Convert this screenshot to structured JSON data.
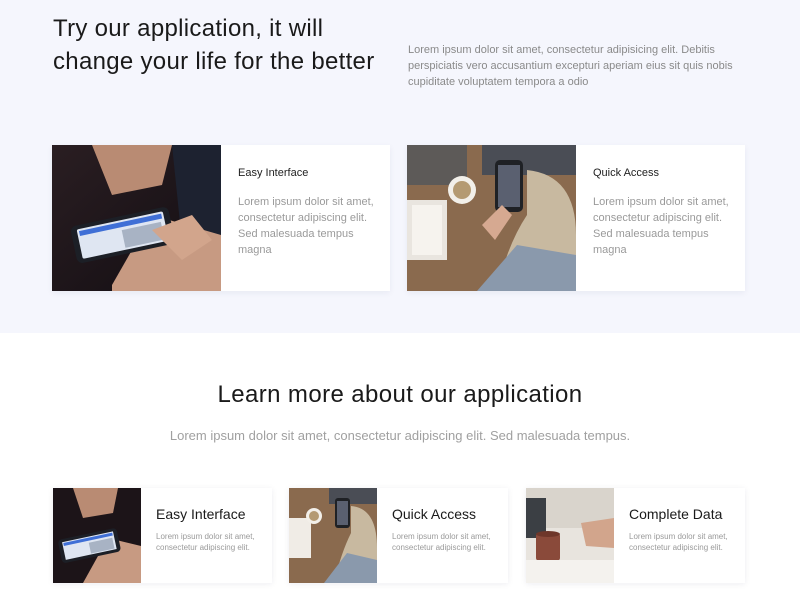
{
  "hero": {
    "title": "Try our application, it will change your life for the better",
    "description": "Lorem ipsum dolor sit amet, consectetur adipisicing elit. Debitis perspiciatis vero accusantium excepturi aperiam eius sit quis nobis cupiditate voluptatem tempora a odio"
  },
  "features": [
    {
      "title": "Easy Interface",
      "text": "Lorem ipsum dolor sit amet, consectetur adipiscing elit. Sed malesuada tempus magna",
      "image": "hand-holding-phone-photo"
    },
    {
      "title": "Quick Access",
      "text": "Lorem ipsum dolor sit amet, consectetur adipiscing elit. Sed malesuada tempus magna",
      "image": "desk-with-phone-and-coffee-photo"
    }
  ],
  "learn_more": {
    "title": "Learn more about our application",
    "subtitle": "Lorem ipsum dolor sit amet, consectetur adipiscing elit. Sed malesuada tempus."
  },
  "small_cards": [
    {
      "title": "Easy Interface",
      "text": "Lorem ipsum dolor sit amet, consectetur adipiscing elit.",
      "image": "hand-holding-phone-photo"
    },
    {
      "title": "Quick Access",
      "text": "Lorem ipsum dolor sit amet, consectetur adipiscing elit.",
      "image": "desk-with-phone-and-coffee-photo"
    },
    {
      "title": "Complete Data",
      "text": "Lorem ipsum dolor sit amet, consectetur adipiscing elit.",
      "image": "desk-with-cup-and-hands-photo"
    }
  ],
  "colors": {
    "top_background": "#f5f6fd",
    "muted_text": "#9a9a9a",
    "heading_text": "#1a1a1a"
  }
}
